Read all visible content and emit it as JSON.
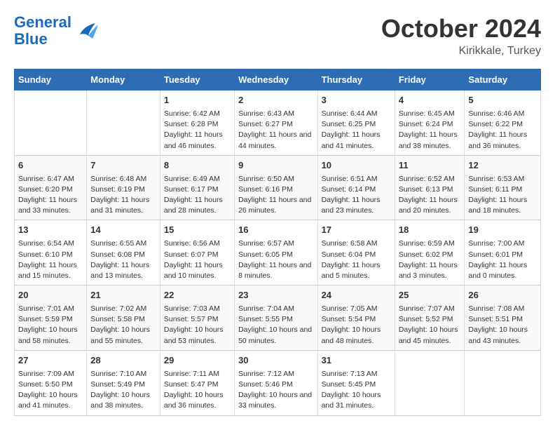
{
  "header": {
    "logo_line1": "General",
    "logo_line2": "Blue",
    "month": "October 2024",
    "location": "Kirikkale, Turkey"
  },
  "columns": [
    "Sunday",
    "Monday",
    "Tuesday",
    "Wednesday",
    "Thursday",
    "Friday",
    "Saturday"
  ],
  "weeks": [
    [
      {
        "day": "",
        "content": ""
      },
      {
        "day": "",
        "content": ""
      },
      {
        "day": "1",
        "content": "Sunrise: 6:42 AM\nSunset: 6:28 PM\nDaylight: 11 hours and 46 minutes."
      },
      {
        "day": "2",
        "content": "Sunrise: 6:43 AM\nSunset: 6:27 PM\nDaylight: 11 hours and 44 minutes."
      },
      {
        "day": "3",
        "content": "Sunrise: 6:44 AM\nSunset: 6:25 PM\nDaylight: 11 hours and 41 minutes."
      },
      {
        "day": "4",
        "content": "Sunrise: 6:45 AM\nSunset: 6:24 PM\nDaylight: 11 hours and 38 minutes."
      },
      {
        "day": "5",
        "content": "Sunrise: 6:46 AM\nSunset: 6:22 PM\nDaylight: 11 hours and 36 minutes."
      }
    ],
    [
      {
        "day": "6",
        "content": "Sunrise: 6:47 AM\nSunset: 6:20 PM\nDaylight: 11 hours and 33 minutes."
      },
      {
        "day": "7",
        "content": "Sunrise: 6:48 AM\nSunset: 6:19 PM\nDaylight: 11 hours and 31 minutes."
      },
      {
        "day": "8",
        "content": "Sunrise: 6:49 AM\nSunset: 6:17 PM\nDaylight: 11 hours and 28 minutes."
      },
      {
        "day": "9",
        "content": "Sunrise: 6:50 AM\nSunset: 6:16 PM\nDaylight: 11 hours and 26 minutes."
      },
      {
        "day": "10",
        "content": "Sunrise: 6:51 AM\nSunset: 6:14 PM\nDaylight: 11 hours and 23 minutes."
      },
      {
        "day": "11",
        "content": "Sunrise: 6:52 AM\nSunset: 6:13 PM\nDaylight: 11 hours and 20 minutes."
      },
      {
        "day": "12",
        "content": "Sunrise: 6:53 AM\nSunset: 6:11 PM\nDaylight: 11 hours and 18 minutes."
      }
    ],
    [
      {
        "day": "13",
        "content": "Sunrise: 6:54 AM\nSunset: 6:10 PM\nDaylight: 11 hours and 15 minutes."
      },
      {
        "day": "14",
        "content": "Sunrise: 6:55 AM\nSunset: 6:08 PM\nDaylight: 11 hours and 13 minutes."
      },
      {
        "day": "15",
        "content": "Sunrise: 6:56 AM\nSunset: 6:07 PM\nDaylight: 11 hours and 10 minutes."
      },
      {
        "day": "16",
        "content": "Sunrise: 6:57 AM\nSunset: 6:05 PM\nDaylight: 11 hours and 8 minutes."
      },
      {
        "day": "17",
        "content": "Sunrise: 6:58 AM\nSunset: 6:04 PM\nDaylight: 11 hours and 5 minutes."
      },
      {
        "day": "18",
        "content": "Sunrise: 6:59 AM\nSunset: 6:02 PM\nDaylight: 11 hours and 3 minutes."
      },
      {
        "day": "19",
        "content": "Sunrise: 7:00 AM\nSunset: 6:01 PM\nDaylight: 11 hours and 0 minutes."
      }
    ],
    [
      {
        "day": "20",
        "content": "Sunrise: 7:01 AM\nSunset: 5:59 PM\nDaylight: 10 hours and 58 minutes."
      },
      {
        "day": "21",
        "content": "Sunrise: 7:02 AM\nSunset: 5:58 PM\nDaylight: 10 hours and 55 minutes."
      },
      {
        "day": "22",
        "content": "Sunrise: 7:03 AM\nSunset: 5:57 PM\nDaylight: 10 hours and 53 minutes."
      },
      {
        "day": "23",
        "content": "Sunrise: 7:04 AM\nSunset: 5:55 PM\nDaylight: 10 hours and 50 minutes."
      },
      {
        "day": "24",
        "content": "Sunrise: 7:05 AM\nSunset: 5:54 PM\nDaylight: 10 hours and 48 minutes."
      },
      {
        "day": "25",
        "content": "Sunrise: 7:07 AM\nSunset: 5:52 PM\nDaylight: 10 hours and 45 minutes."
      },
      {
        "day": "26",
        "content": "Sunrise: 7:08 AM\nSunset: 5:51 PM\nDaylight: 10 hours and 43 minutes."
      }
    ],
    [
      {
        "day": "27",
        "content": "Sunrise: 7:09 AM\nSunset: 5:50 PM\nDaylight: 10 hours and 41 minutes."
      },
      {
        "day": "28",
        "content": "Sunrise: 7:10 AM\nSunset: 5:49 PM\nDaylight: 10 hours and 38 minutes."
      },
      {
        "day": "29",
        "content": "Sunrise: 7:11 AM\nSunset: 5:47 PM\nDaylight: 10 hours and 36 minutes."
      },
      {
        "day": "30",
        "content": "Sunrise: 7:12 AM\nSunset: 5:46 PM\nDaylight: 10 hours and 33 minutes."
      },
      {
        "day": "31",
        "content": "Sunrise: 7:13 AM\nSunset: 5:45 PM\nDaylight: 10 hours and 31 minutes."
      },
      {
        "day": "",
        "content": ""
      },
      {
        "day": "",
        "content": ""
      }
    ]
  ]
}
